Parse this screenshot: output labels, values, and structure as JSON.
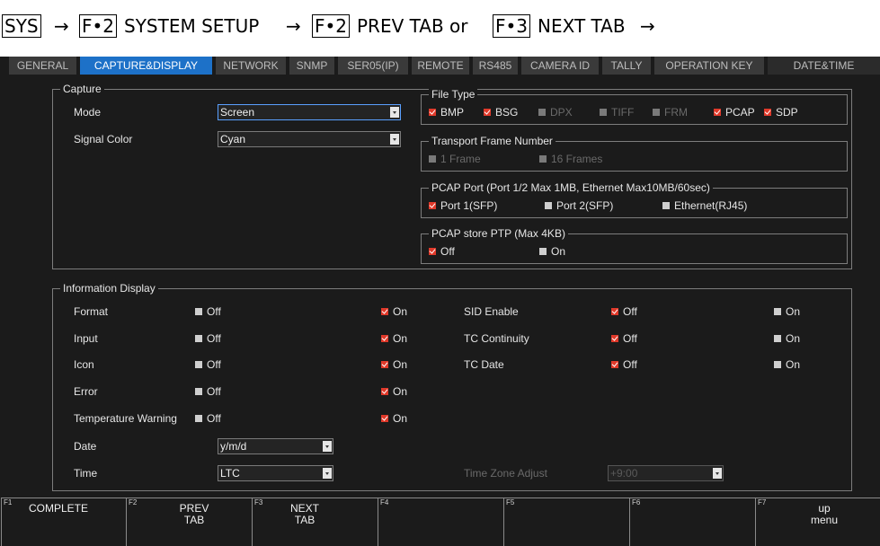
{
  "breadcrumb": {
    "p1": "SYS",
    "arrow": "→",
    "k1": "F•2",
    "p2": "SYSTEM SETUP",
    "k2": "F•2",
    "p3": "PREV TAB or",
    "k3": "F•3",
    "p4": "NEXT TAB"
  },
  "tabs": [
    "GENERAL",
    "CAPTURE&DISPLAY",
    "NETWORK",
    "SNMP",
    "SER05(IP)",
    "REMOTE",
    "RS485",
    "CAMERA ID",
    "TALLY",
    "OPERATION KEY",
    "DATE&TIME"
  ],
  "capture": {
    "title": "Capture",
    "mode_label": "Mode",
    "mode_value": "Screen",
    "signal_color_label": "Signal Color",
    "signal_color_value": "Cyan",
    "file_type": {
      "title": "File Type",
      "options": [
        {
          "label": "BMP",
          "state": "on"
        },
        {
          "label": "BSG",
          "state": "on"
        },
        {
          "label": "DPX",
          "state": "dim"
        },
        {
          "label": "TIFF",
          "state": "dim"
        },
        {
          "label": "FRM",
          "state": "dim"
        },
        {
          "label": "PCAP",
          "state": "on"
        },
        {
          "label": "SDP",
          "state": "on"
        }
      ]
    },
    "transport_frame": {
      "title": "Transport Frame Number",
      "options": [
        {
          "label": "1 Frame",
          "state": "dim"
        },
        {
          "label": "16 Frames",
          "state": "dim"
        }
      ]
    },
    "pcap_port": {
      "title": "PCAP Port (Port 1/2 Max 1MB, Ethernet Max10MB/60sec)",
      "options": [
        {
          "label": "Port 1(SFP)",
          "state": "on"
        },
        {
          "label": "Port 2(SFP)",
          "state": "off"
        },
        {
          "label": "Ethernet(RJ45)",
          "state": "off"
        }
      ]
    },
    "pcap_ptp": {
      "title": "PCAP store PTP (Max 4KB)",
      "options": [
        {
          "label": "Off",
          "state": "on"
        },
        {
          "label": "On",
          "state": "off"
        }
      ]
    }
  },
  "info": {
    "title": "Information Display",
    "rows": [
      {
        "label": "Format",
        "off": "Off",
        "on": "On",
        "selected": "on"
      },
      {
        "label": "Input",
        "off": "Off",
        "on": "On",
        "selected": "on"
      },
      {
        "label": "Icon",
        "off": "Off",
        "on": "On",
        "selected": "on"
      },
      {
        "label": "Error",
        "off": "Off",
        "on": "On",
        "selected": "on"
      },
      {
        "label": "Temperature Warning",
        "off": "Off",
        "on": "On",
        "selected": "on"
      }
    ],
    "right_rows": [
      {
        "label": "SID Enable",
        "off": "Off",
        "on": "On",
        "selected": "off"
      },
      {
        "label": "TC Continuity",
        "off": "Off",
        "on": "On",
        "selected": "off"
      },
      {
        "label": "TC Date",
        "off": "Off",
        "on": "On",
        "selected": "off"
      }
    ],
    "date_label": "Date",
    "date_value": "y/m/d",
    "time_label": "Time",
    "time_value": "LTC",
    "tz_label": "Time Zone Adjust",
    "tz_value": "+9:00"
  },
  "fkeys": [
    {
      "num": "F1",
      "label": "COMPLETE"
    },
    {
      "num": "F2",
      "label": "PREV\nTAB"
    },
    {
      "num": "F3",
      "label": "NEXT\nTAB"
    },
    {
      "num": "F4",
      "label": ""
    },
    {
      "num": "F5",
      "label": ""
    },
    {
      "num": "F6",
      "label": ""
    },
    {
      "num": "F7",
      "label": "up\nmenu"
    }
  ],
  "colors": {
    "active_tab": "#1d71c8",
    "checked": "#e0392a",
    "background": "#1b1b1b"
  }
}
